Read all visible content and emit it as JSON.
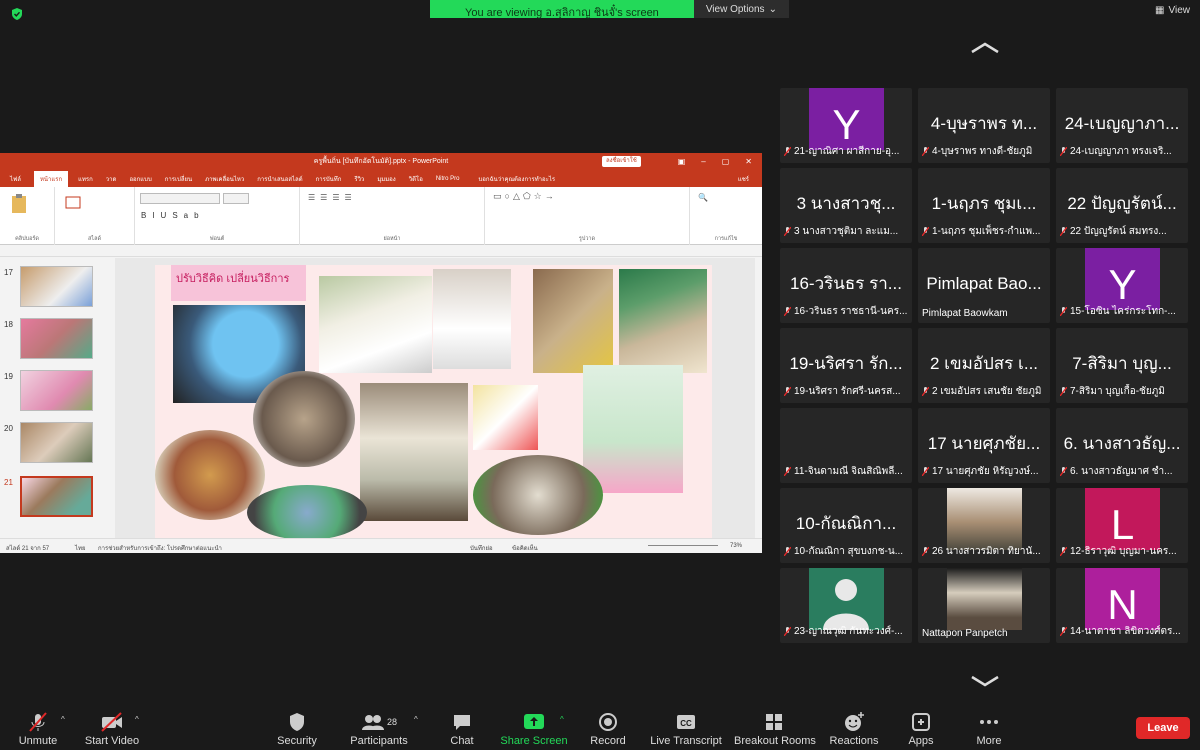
{
  "top": {
    "viewing": "You are viewing อ.สุลิกาญ ชินจั๋'s screen",
    "view_options": "View Options",
    "view": "View"
  },
  "ppt": {
    "title": "ครูพื้นถิ่น [บันทึกอัตโนมัติ].pptx - PowerPoint",
    "share_btn": "ลงชื่อเข้าใช้",
    "tabs": [
      "ไฟล์",
      "หน้าแรก",
      "แทรก",
      "วาด",
      "ออกแบบ",
      "การเปลี่ยน",
      "ภาพเคลื่อนไหว",
      "การนำเสนอสไลด์",
      "การบันทึก",
      "รีวิว",
      "มุมมอง",
      "วิดีโอ",
      "Nitro Pro",
      "บอกฉันว่าคุณต้องการทำอะไร",
      "แชร์"
    ],
    "groups": [
      "คลิปบอร์ด",
      "สไลด์",
      "ฟอนต์",
      "ย่อหน้า",
      "รูปวาด",
      "การแก้ไข"
    ],
    "slide_numbers": [
      "17",
      "18",
      "19",
      "20",
      "21"
    ],
    "slide_title": "ปรับวิธีคิด เปลี่ยนวิธีการ",
    "status_left": "สไลด์ 21 จาก 57",
    "status_lang": "ไทย",
    "status_access": "การช่วยสำหรับการเข้าถึง: โปรดศึกษาต่อแนะนำ",
    "status_notes": "บันทึกย่อ",
    "status_comments": "ข้อคิดเห็น",
    "zoom": "73%"
  },
  "tiles": [
    {
      "big": "",
      "avatar": "Y",
      "avatar_color": "#7b1fa2",
      "name": "21-ญาณิศา ผาสีกาย-อุ..."
    },
    {
      "big": "4-บุษราพร ท...",
      "name": "4-บุษราพร ทางดี-ชัยภูมิ"
    },
    {
      "big": "24-เบญญาภา...",
      "name": "24-เบญญาภา ทรงเจริ..."
    },
    {
      "big": "3 นางสาวชุ...",
      "name": "3 นางสาวชุติมา ละแม..."
    },
    {
      "big": "1-นฤภร ชุมเ...",
      "name": "1-นฤภร ชุมเพ็ชร-กำแพ..."
    },
    {
      "big": "22 ปัญญูรัตน์...",
      "name": "22 ปัญญูรัตน์ สมทรง..."
    },
    {
      "big": "16-วรินธร รา...",
      "name": "16-วรินธร ราชธานี-นคร..."
    },
    {
      "big": "Pimlapat Bao...",
      "name": "Pimlapat Baowkam"
    },
    {
      "big": "",
      "avatar": "Y",
      "avatar_color": "#7b1fa2",
      "name": "15-โอซิน ไคร่กระโทก-..."
    },
    {
      "big": "19-นริศรา รัก...",
      "name": "19-นริศรา รักศรี-นครส..."
    },
    {
      "big": "2 เขมอัปสร เ...",
      "name": "2 เขมอัปสร เสนชัย ชัยภูมิ"
    },
    {
      "big": "7-สิริมา บุญ...",
      "name": "7-สิริมา บุญเกื้อ-ชัยภูมิ"
    },
    {
      "big": "",
      "name": "11-จินดามณี จิณสิณิพลี..."
    },
    {
      "big": "17 นายศุภชัย...",
      "name": "17 นายศุภชัย หิรัญวงษ์..."
    },
    {
      "big": "6. นางสาวธัญ...",
      "name": "6. นางสาวธัญมาศ ชำ..."
    },
    {
      "big": "10-กัณณิกา...",
      "name": "10-กัณณิกา สุขบงกช-น..."
    },
    {
      "big": "",
      "video": true,
      "name": "26 นางสาวรมิตา ทิยานั..."
    },
    {
      "big": "",
      "avatar": "L",
      "avatar_color": "#c2185b",
      "name": "12-ธิราวุฒิ บุญมา-นคร..."
    },
    {
      "big": "",
      "generic": true,
      "name": "23-ญาณวุฒิ กันทะวงศ์-..."
    },
    {
      "big": "",
      "video": true,
      "name": "Nattapon Panpetch"
    },
    {
      "big": "",
      "avatar": "N",
      "avatar_color": "#ad1f9c",
      "name": "14-นาตาชา ลิขิตวงศ์ตร..."
    }
  ],
  "toolbar": {
    "unmute": "Unmute",
    "start_video": "Start Video",
    "security": "Security",
    "participants": "Participants",
    "participants_count": "28",
    "chat": "Chat",
    "share": "Share Screen",
    "record": "Record",
    "transcript": "Live Transcript",
    "breakout": "Breakout Rooms",
    "reactions": "Reactions",
    "apps": "Apps",
    "more": "More",
    "leave": "Leave"
  },
  "colors": {
    "share_green": "#23d959",
    "ppt_red": "#c4391e",
    "leave_red": "#e02828"
  }
}
